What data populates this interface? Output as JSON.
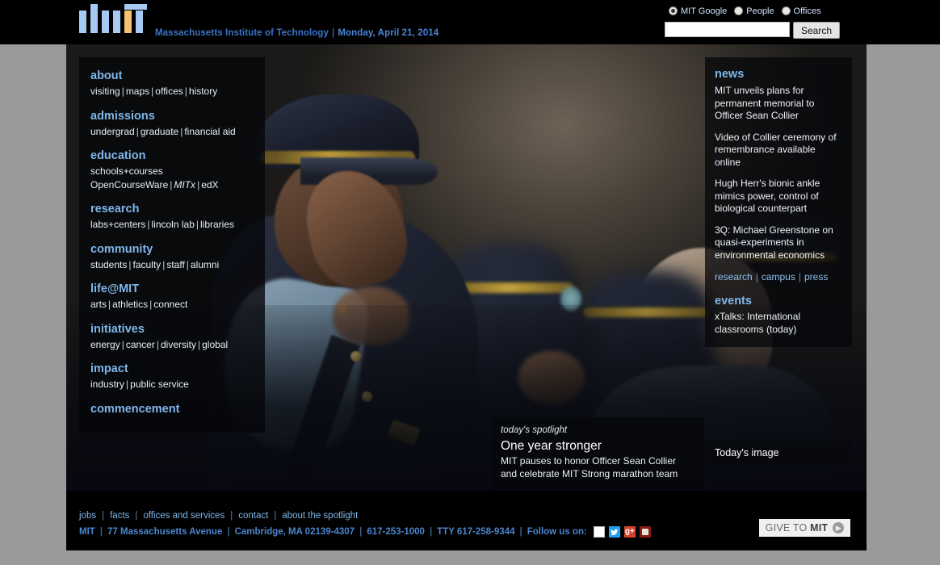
{
  "header": {
    "logo_alt": "MIT",
    "tagline": "Massachusetts Institute of Technology",
    "separator": "|",
    "date": "Monday, April 21, 2014"
  },
  "search": {
    "options": [
      {
        "label": "MIT Google",
        "selected": true
      },
      {
        "label": "People",
        "selected": false
      },
      {
        "label": "Offices",
        "selected": false
      }
    ],
    "value": "",
    "placeholder": "",
    "button_label": "Search"
  },
  "nav": {
    "sections": [
      {
        "head": "about",
        "links": [
          "visiting",
          "maps",
          "offices",
          "history"
        ]
      },
      {
        "head": "admissions",
        "links": [
          "undergrad",
          "graduate",
          "financial aid"
        ]
      },
      {
        "head": "education",
        "line1": [
          "schools+courses"
        ],
        "links": [
          "OpenCourseWare",
          "MITx",
          "edX"
        ]
      },
      {
        "head": "research",
        "links": [
          "labs+centers",
          "lincoln lab",
          "libraries"
        ]
      },
      {
        "head": "community",
        "links": [
          "students",
          "faculty",
          "staff",
          "alumni"
        ]
      },
      {
        "head": "life@MIT",
        "links": [
          "arts",
          "athletics",
          "connect"
        ]
      },
      {
        "head": "initiatives",
        "links": [
          "energy",
          "cancer",
          "diversity",
          "global"
        ]
      },
      {
        "head": "impact",
        "links": [
          "industry",
          "public service"
        ]
      },
      {
        "head": "commencement",
        "links": []
      }
    ]
  },
  "news": {
    "head": "news",
    "items": [
      "MIT unveils plans for permanent memorial to Officer Sean Collier",
      "Video of Collier ceremony of remembrance available online",
      "Hugh Herr's bionic ankle mimics power, control of biological counterpart",
      "3Q: Michael Greenstone on quasi-experiments in environmental economics"
    ],
    "categories": [
      "research",
      "campus",
      "press"
    ],
    "events_head": "events",
    "events": [
      "xTalks: International classrooms (today)"
    ]
  },
  "todays_image": {
    "label": "Today's image"
  },
  "spotlight": {
    "kicker": "today's spotlight",
    "title": "One year stronger",
    "description": "MIT pauses to honor Officer Sean Collier and celebrate MIT Strong marathon team"
  },
  "footer": {
    "links": [
      "jobs",
      "facts",
      "offices and services",
      "contact",
      "about the spotlight"
    ],
    "address": [
      "MIT",
      "77 Massachusetts Avenue",
      "Cambridge, MA 02139-4307",
      "617-253-1000",
      "TTY 617-258-9344"
    ],
    "follow_label": "Follow us on:",
    "social": [
      "facebook-icon",
      "twitter-icon",
      "googleplus-icon",
      "youtube-icon"
    ],
    "give_label_light": "GIVE TO ",
    "give_label_bold": "MIT",
    "give_arrow": "▶"
  },
  "colors": {
    "accent_blue": "#7fb6ea",
    "link_blue": "#4b86cd",
    "logo_blue": "#a5caf3",
    "logo_orange": "#f5c372",
    "page_bg": "#9a9a9a"
  }
}
